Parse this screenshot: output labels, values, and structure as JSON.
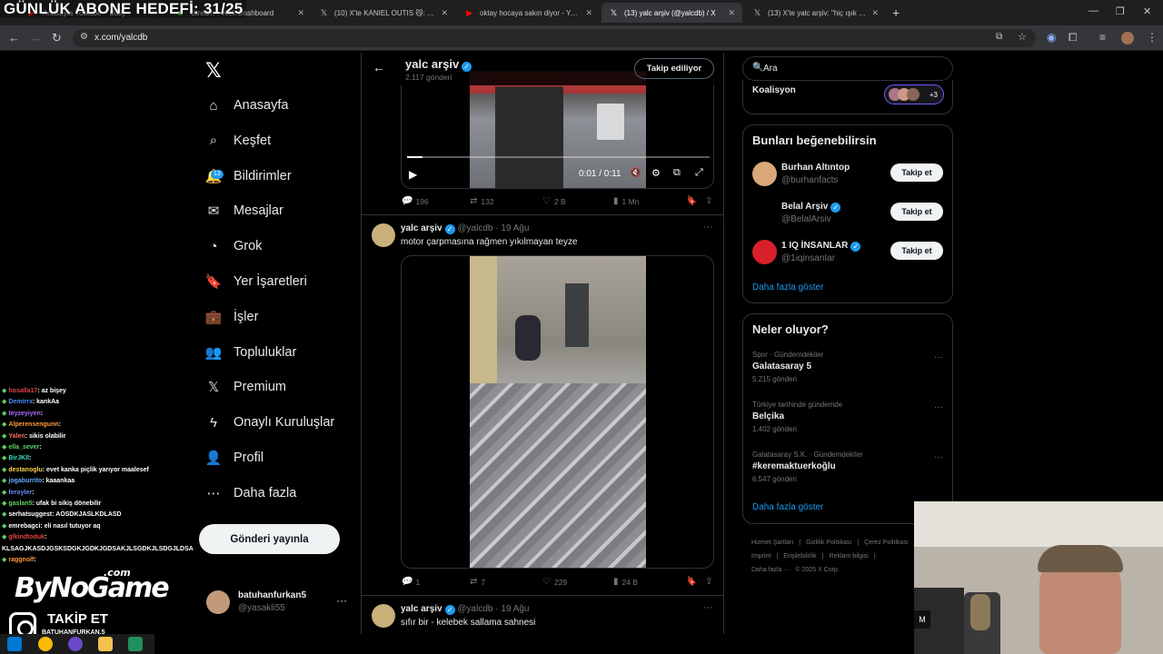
{
  "overlay": {
    "goal": "GÜNLÜK ABONE HEDEFİ: 31/25"
  },
  "tabs": [
    {
      "title": "Anasayfa Youtube – BuJy",
      "icon": "youtube-icon",
      "color": "#ff0000"
    },
    {
      "title": "Stream – Kick Dashboard",
      "icon": "kick-icon",
      "color": "#53fc18"
    },
    {
      "title": "(10) X'te KANIEL OUTIS 😼: \"O...",
      "icon": "x-icon",
      "color": "#ffffff"
    },
    {
      "title": "oktay hocaya sakın diyor - YouT...",
      "icon": "youtube-icon",
      "color": "#ff0000"
    },
    {
      "title": "(13) yalc arşiv (@yalcdb) / X",
      "icon": "x-icon",
      "color": "#ffffff",
      "active": true
    },
    {
      "title": "(13) X'te yalc arşiv: \"hiç ışık yok...",
      "icon": "x-icon",
      "color": "#ffffff"
    }
  ],
  "browser": {
    "url": "x.com/yalcdb"
  },
  "chat": [
    {
      "user": "hosalla17",
      "msg": ": az bişey",
      "color": "#e04343"
    },
    {
      "user": "Demirrx",
      "msg": ": kankAa",
      "color": "#4a8cff"
    },
    {
      "user": "teyzeyiyen",
      "msg": ":",
      "color": "#b36bff"
    },
    {
      "user": "Alperensengunn",
      "msg": ":",
      "color": "#ff9a3c"
    },
    {
      "user": "Yalen",
      "msg": ": sikis olabilir",
      "color": "#ff6b6b"
    },
    {
      "user": "ella_sever",
      "msg": ":",
      "color": "#5fd35f"
    },
    {
      "user": "BirJKll",
      "msg": ":",
      "color": "#3ce0c0"
    },
    {
      "user": "destanoglu",
      "msg": ": evet kanka piçlik yarıyor maalesef",
      "color": "#ffd24a"
    },
    {
      "user": "jogaburrito",
      "msg": ": kaaankaa",
      "color": "#5fb0ff"
    },
    {
      "user": "feroyler",
      "msg": ":",
      "color": "#6b8cff"
    },
    {
      "user": "gaslan5",
      "msg": ": ufak bi sikiş dönebilir",
      "color": "#5fd35f"
    },
    {
      "user": "serhatsuggest",
      "msg": ": AÖSDKJASLKDLASD",
      "color": "#ffffff"
    },
    {
      "user": "emrebagci",
      "msg": ": eli nasıl tutuyor aq",
      "color": "#ffffff"
    },
    {
      "user": "glkindtoduk",
      "msg": ": KLSAGJKASDJGSKSDGKJGDKJGDSAKJLSGDKJLSDGJLDSA",
      "color": "#e04343"
    },
    {
      "user": "raggnolf",
      "msg": ":",
      "color": "#ff9a3c"
    }
  ],
  "stream_brand": {
    "logo": "ByNoGame",
    "com": ".com",
    "cta": "TAKİP ET",
    "handle": "BATUHANFURKAN.5"
  },
  "nav": {
    "items": [
      {
        "label": "Anasayfa",
        "icon": "home-icon"
      },
      {
        "label": "Keşfet",
        "icon": "search-icon"
      },
      {
        "label": "Bildirimler",
        "icon": "bell-icon",
        "badge": "13"
      },
      {
        "label": "Mesajlar",
        "icon": "mail-icon"
      },
      {
        "label": "Grok",
        "icon": "grok-icon"
      },
      {
        "label": "Yer İşaretleri",
        "icon": "bookmark-icon"
      },
      {
        "label": "İşler",
        "icon": "briefcase-icon"
      },
      {
        "label": "Topluluklar",
        "icon": "people-icon"
      },
      {
        "label": "Premium",
        "icon": "x-premium-icon"
      },
      {
        "label": "Onaylı Kuruluşlar",
        "icon": "lightning-icon"
      },
      {
        "label": "Profil",
        "icon": "person-icon"
      },
      {
        "label": "Daha fazla",
        "icon": "more-circle-icon"
      }
    ],
    "post_label": "Gönderi yayınla",
    "account": {
      "name": "batuhanfurkan5",
      "handle": "@yasakli55"
    }
  },
  "profile": {
    "name": "yalc arşiv",
    "posts": "2.117 gönderi",
    "follow_label": "Takip ediliyor"
  },
  "video1": {
    "time": "0:01 / 0:11",
    "progress": 0.05
  },
  "tweets": [
    {
      "replies": "196",
      "reposts": "132",
      "likes": "2 B",
      "views": "1 Mn"
    },
    {
      "name": "yalc arşiv",
      "handle": "@yalcdb",
      "date": "· 19 Ağu",
      "text": "motor çarpmasına rağmen yıkılmayan teyze",
      "replies": "1",
      "reposts": "7",
      "likes": "229",
      "views": "24 B"
    },
    {
      "name": "yalc arşiv",
      "handle": "@yalcdb",
      "date": "· 19 Ağu",
      "text": "sıfır bir - kelebek sallama sahnesi"
    }
  ],
  "right": {
    "search_placeholder": "Ara",
    "koalisyon": {
      "label": "Koalisyon",
      "more": "+3"
    },
    "suggest_title": "Bunları beğenebilirsin",
    "suggestions": [
      {
        "name": "Burhan Altıntop",
        "handle": "@burhanfacts",
        "verified": false,
        "color": "#d9a878"
      },
      {
        "name": "Belal Arşiv",
        "handle": "@BelalArsiv",
        "verified": true,
        "color": "#000000"
      },
      {
        "name": "1 IQ İNSANLAR",
        "handle": "@1iqinsanIar",
        "verified": true,
        "color": "#d8202a"
      }
    ],
    "follow_label": "Takip et",
    "show_more": "Daha fazla göster",
    "trends_title": "Neler oluyor?",
    "trends": [
      {
        "context": "Spor · Gündemdekiler",
        "title": "Galatasaray 5",
        "posts": "5.215 gönderi"
      },
      {
        "context": "Türkiye tarihinde gündemde",
        "title": "Belçika",
        "posts": "1.402 gönderi"
      },
      {
        "context": "Galatasaray S.K. · Gündemdekiler",
        "title": "#keremaktuerkoğlu",
        "posts": "6.547 gönderi"
      }
    ],
    "footer": [
      "Hizmet Şartları",
      "|",
      "Gizlilik Politikası",
      "|",
      "Çerez Politikası",
      "Imprint",
      "|",
      "Erişilebilirlik",
      "|",
      "Reklam bilgisi",
      "|",
      "Daha fazla ···",
      "© 2025 X Corp."
    ]
  }
}
